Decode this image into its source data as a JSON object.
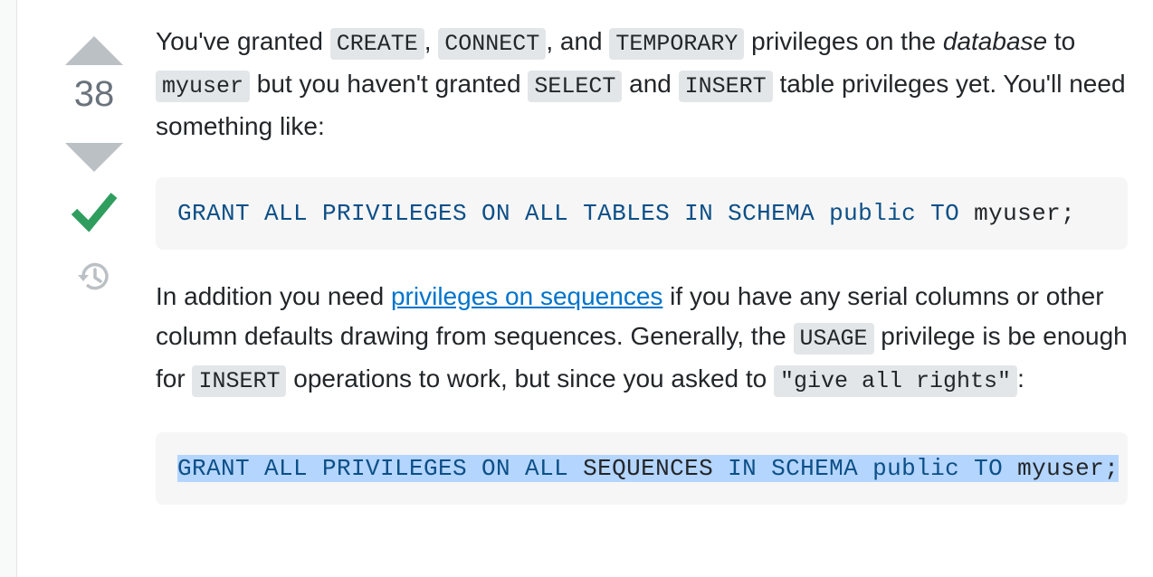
{
  "vote": {
    "count": "38"
  },
  "post": {
    "p1": {
      "t1": "You've granted ",
      "c1": "CREATE",
      "t2": ", ",
      "c2": "CONNECT",
      "t3": ", and ",
      "c3": "TEMPORARY",
      "t4": " privileges on the ",
      "em": "database",
      "t5": " to ",
      "c4": "myuser",
      "t6": " but you haven't granted ",
      "c5": "SELECT",
      "t7": " and ",
      "c6": "INSERT",
      "t8": " table privileges yet. You'll need something like:"
    },
    "code1": {
      "k1": "GRANT ALL PRIVILEGES ON ALL TABLES IN SCHEMA public TO",
      "i1": " myuser;"
    },
    "p2": {
      "t1": "In addition you need ",
      "link": "privileges on sequences",
      "t2": " if you have any serial columns or other column defaults drawing from sequences. Generally, the ",
      "c1": "USAGE",
      "t3": " privilege is be enough for ",
      "c2": "INSERT",
      "t4": " operations to work, but since you asked to ",
      "c3": "\"give all rights\"",
      "t5": ":"
    },
    "code2": {
      "k1": "GRANT ALL PRIVILEGES ON ALL",
      "i1": " SEQUENCES ",
      "k2": "IN SCHEMA public TO",
      "i2": " myuser;"
    }
  },
  "icons": {
    "upvote": "upvote-arrow-icon",
    "downvote": "downvote-arrow-icon",
    "accepted": "checkmark-icon",
    "history": "history-icon"
  },
  "colors": {
    "vote_arrow": "#bbc0c4",
    "accepted": "#2f9d5e",
    "link": "#0074cc",
    "keyword": "#0c4f87",
    "selection": "#b4d5fe"
  }
}
